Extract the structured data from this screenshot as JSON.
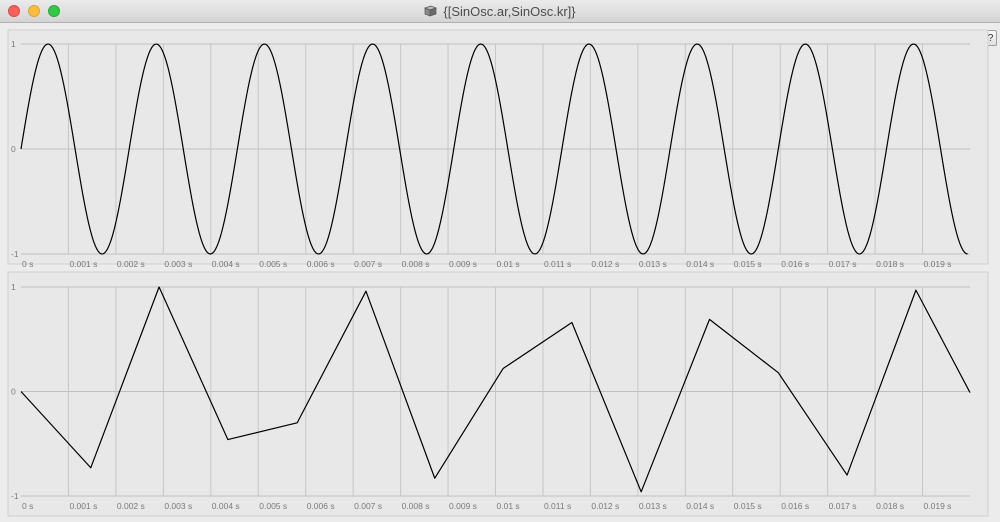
{
  "window": {
    "title": "{[SinOsc.ar,SinOsc.kr]}",
    "help_label": "?"
  },
  "chart_data": [
    {
      "type": "line",
      "series": [
        {
          "kind": "sine",
          "cycles": 8.75,
          "samples": 600,
          "x_end": 0.01995
        }
      ],
      "ylim": [
        -1,
        1
      ],
      "y_ticks": [
        "1",
        "0",
        "-1"
      ],
      "xlim": [
        0,
        0.02
      ],
      "x_ticks": [
        "0 s",
        "0.001 s",
        "0.002 s",
        "0.003 s",
        "0.004 s",
        "0.005 s",
        "0.006 s",
        "0.007 s",
        "0.008 s",
        "0.009 s",
        "0.01 s",
        "0.011 s",
        "0.012 s",
        "0.013 s",
        "0.014 s",
        "0.015 s",
        "0.016 s",
        "0.017 s",
        "0.018 s",
        "0.019 s"
      ],
      "grid": true
    },
    {
      "type": "line",
      "series": [
        {
          "x": [
            0,
            0.00147,
            0.00291,
            0.00436,
            0.00582,
            0.00727,
            0.00872,
            0.01016,
            0.01161,
            0.01307,
            0.01451,
            0.01596,
            0.01741,
            0.01886,
            0.02
          ],
          "y": [
            0,
            -0.73,
            1.0,
            -0.46,
            -0.3,
            0.96,
            -0.83,
            0.22,
            0.66,
            -0.96,
            0.69,
            0.18,
            -0.8,
            0.97,
            -0.01
          ]
        }
      ],
      "ylim": [
        -1,
        1
      ],
      "y_ticks": [
        "1",
        "0",
        "-1"
      ],
      "xlim": [
        0,
        0.02
      ],
      "x_ticks": [
        "0 s",
        "0.001 s",
        "0.002 s",
        "0.003 s",
        "0.004 s",
        "0.005 s",
        "0.006 s",
        "0.007 s",
        "0.008 s",
        "0.009 s",
        "0.01 s",
        "0.011 s",
        "0.012 s",
        "0.013 s",
        "0.014 s",
        "0.015 s",
        "0.016 s",
        "0.017 s",
        "0.018 s",
        "0.019 s"
      ],
      "grid": true
    }
  ]
}
